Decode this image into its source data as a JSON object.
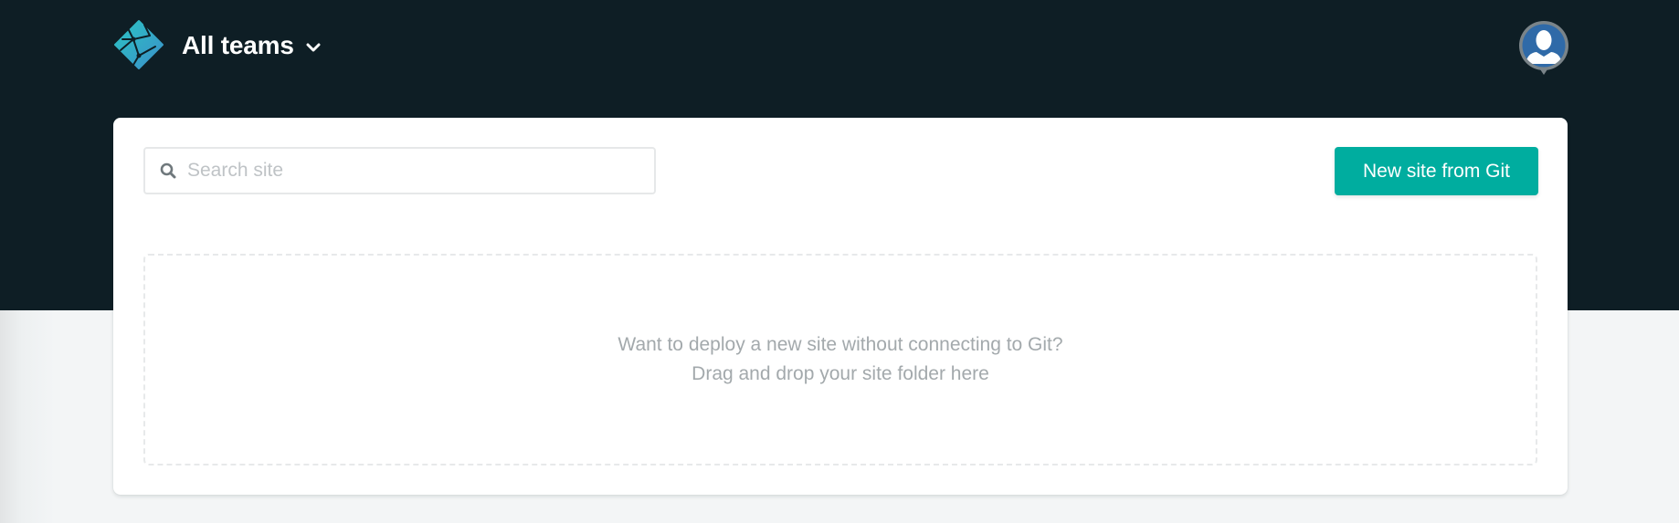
{
  "header": {
    "logo": "netlify-logo-icon",
    "team_switcher": {
      "label": "All teams",
      "icon": "chevron-down-icon"
    },
    "avatar": {
      "icon": "user-avatar-icon"
    }
  },
  "toolbar": {
    "search": {
      "icon": "search-icon",
      "placeholder": "Search site",
      "value": ""
    },
    "new_site_button_label": "New site from Git"
  },
  "dropzone": {
    "line1": "Want to deploy a new site without connecting to Git?",
    "line2": "Drag and drop your site folder here"
  },
  "colors": {
    "header_bg": "#0e1e25",
    "accent": "#00ad9f",
    "page_bg": "#f3f5f6",
    "muted_text": "#a3a9ac"
  }
}
